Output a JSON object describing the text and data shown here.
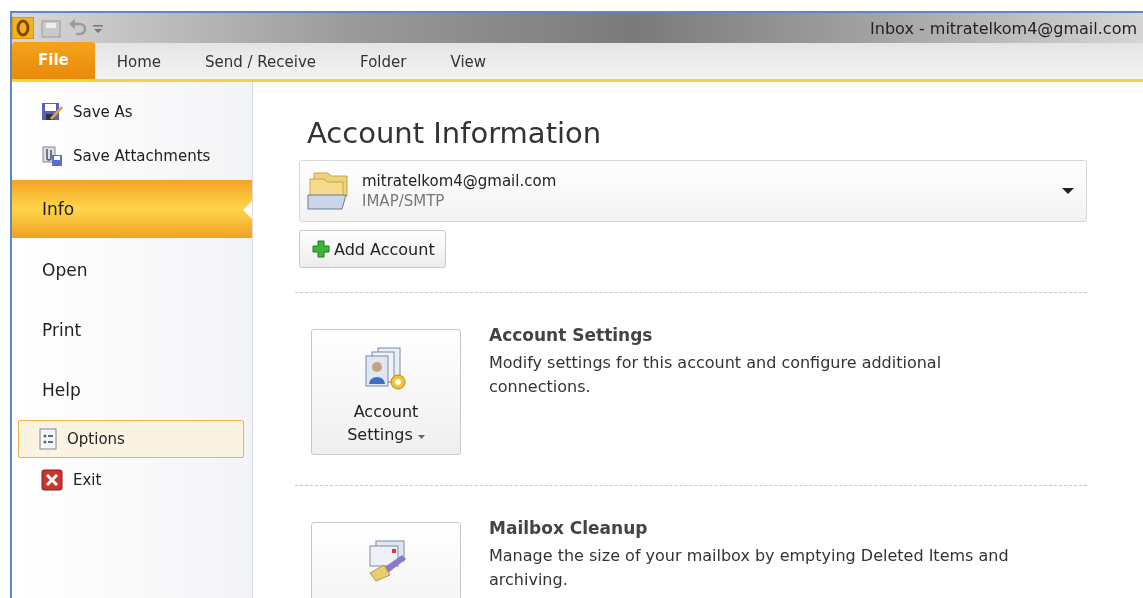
{
  "window": {
    "title": "Inbox - mitratelkom4@gmail.com"
  },
  "ribbon_tabs": [
    {
      "label": "File",
      "selected": true
    },
    {
      "label": "Home",
      "selected": false
    },
    {
      "label": "Send / Receive",
      "selected": false
    },
    {
      "label": "Folder",
      "selected": false
    },
    {
      "label": "View",
      "selected": false
    }
  ],
  "sidebar": {
    "items": [
      {
        "kind": "save-as",
        "label": "Save As",
        "selected": false,
        "highlighted": false
      },
      {
        "kind": "save-attachments",
        "label": "Save Attachments",
        "selected": false,
        "highlighted": false
      },
      {
        "kind": "page",
        "label": "Info",
        "selected": true,
        "highlighted": false
      },
      {
        "kind": "page",
        "label": "Open",
        "selected": false,
        "highlighted": false
      },
      {
        "kind": "page",
        "label": "Print",
        "selected": false,
        "highlighted": false
      },
      {
        "kind": "page",
        "label": "Help",
        "selected": false,
        "highlighted": false
      },
      {
        "kind": "options",
        "label": "Options",
        "selected": false,
        "highlighted": true
      },
      {
        "kind": "exit",
        "label": "Exit",
        "selected": false,
        "highlighted": false
      }
    ]
  },
  "content": {
    "title": "Account Information",
    "account": {
      "address": "mitratelkom4@gmail.com",
      "type": "IMAP/SMTP"
    },
    "add_account": "Add Account",
    "sections": [
      {
        "kind": "account-settings",
        "title": "Account Settings",
        "description": "Modify settings for this account and configure additional connections.",
        "button_lines": [
          "Account",
          "Settings"
        ]
      },
      {
        "kind": "mailbox-cleanup",
        "title": "Mailbox Cleanup",
        "description": "Manage the size of your mailbox by emptying Deleted Items and archiving."
      }
    ]
  }
}
